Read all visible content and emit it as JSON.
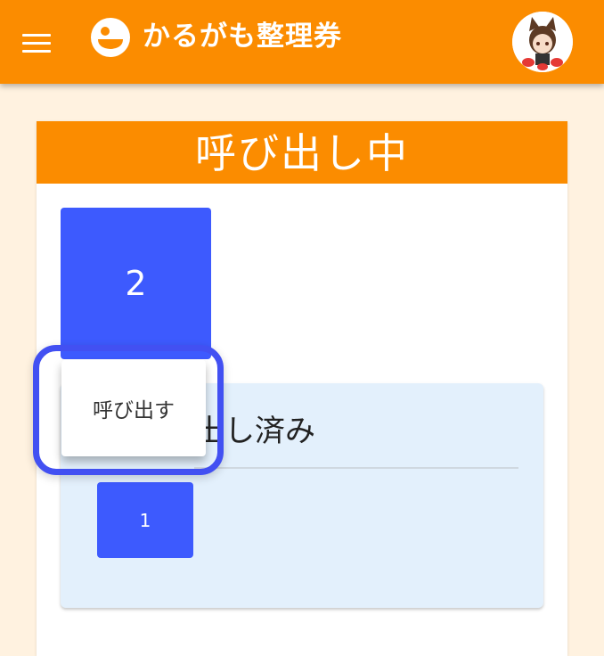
{
  "app_bar": {
    "title": "かるがも整理券",
    "menu_icon": "hamburger-menu-icon",
    "logo_icon": "karugamo-logo-icon",
    "avatar_icon": "user-avatar-icon"
  },
  "colors": {
    "brand_orange": "#fb8c00",
    "ticket_blue": "#3d5afe",
    "highlight_blue": "#4250f2",
    "page_background": "#fff2e0",
    "called_panel_background": "#e3f0fc"
  },
  "calling_section": {
    "header": "呼び出し中",
    "ticket_number": "2",
    "call_button_label": "呼び出す"
  },
  "called_section": {
    "title": "呼び出し済み",
    "tickets": [
      "1"
    ]
  }
}
